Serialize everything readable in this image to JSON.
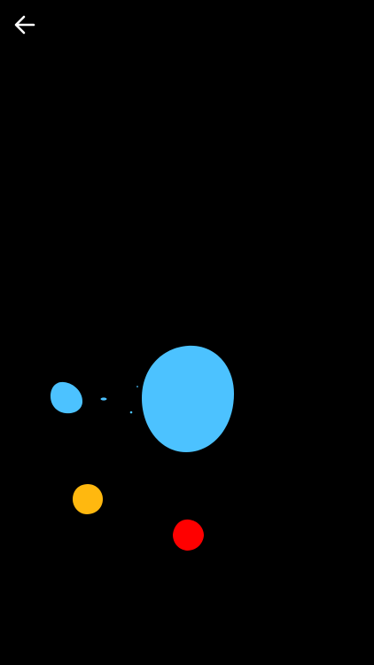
{
  "header": {
    "back_icon": "arrow-left-icon"
  },
  "game": {
    "background_color": "#000000",
    "colors": {
      "blue": "#4CC2FF",
      "yellow": "#FFB80F",
      "red": "#FF0000",
      "icon": "#FFFFFF"
    },
    "blobs": [
      {
        "name": "large-blue-blob",
        "color": "blue"
      },
      {
        "name": "small-blue-blob",
        "color": "blue"
      },
      {
        "name": "yellow-blob",
        "color": "yellow"
      },
      {
        "name": "red-blob",
        "color": "red"
      }
    ],
    "droplets": [
      {
        "name": "blue-droplet",
        "color": "blue"
      },
      {
        "name": "blue-droplet",
        "color": "blue"
      },
      {
        "name": "blue-droplet",
        "color": "blue"
      }
    ]
  }
}
